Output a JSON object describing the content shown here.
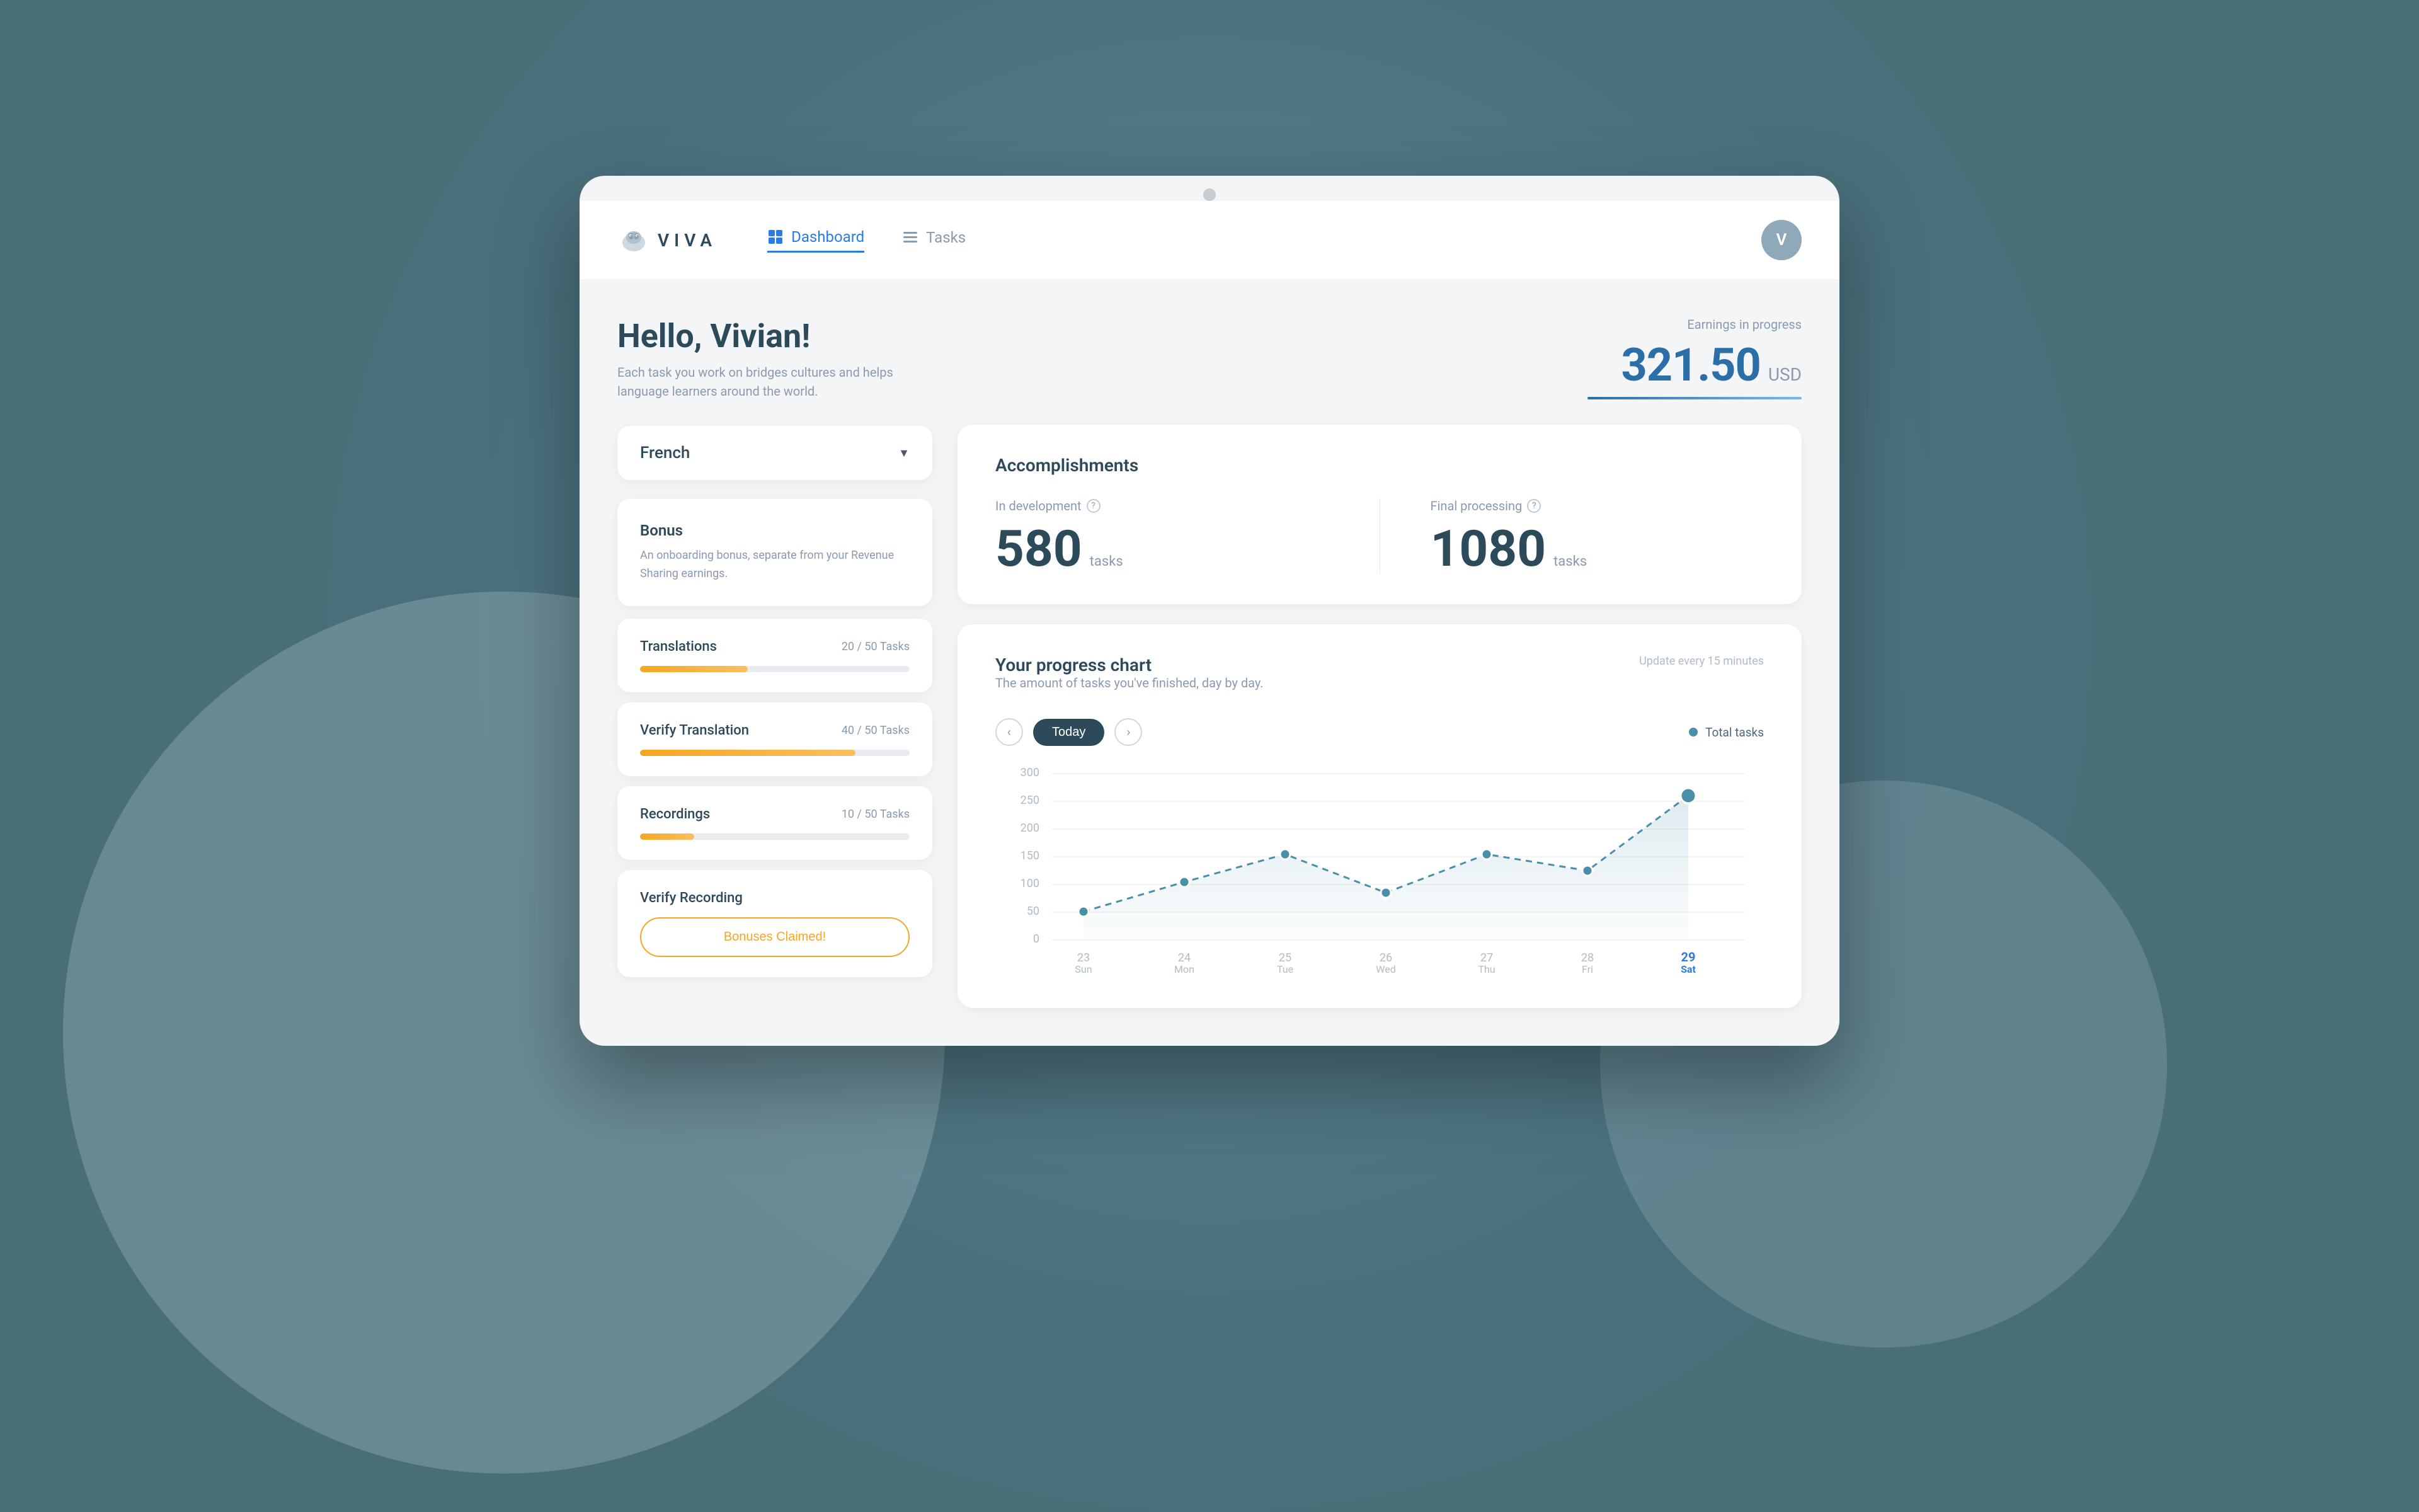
{
  "app": {
    "title": "VIVA",
    "window_dot_color": "#c8cdd4"
  },
  "nav": {
    "dashboard_label": "Dashboard",
    "tasks_label": "Tasks",
    "avatar_initial": "V"
  },
  "greeting": {
    "title": "Hello, Vivian!",
    "subtitle": "Each task you work on bridges cultures and helps language learners around the world."
  },
  "language_selector": {
    "value": "French",
    "arrow": "▼"
  },
  "bonus": {
    "title": "Bonus",
    "description": "An onboarding bonus, separate from your Revenue Sharing earnings."
  },
  "tasks": [
    {
      "name": "Translations",
      "current": 20,
      "total": 50,
      "progress_pct": 40,
      "label": "20 / 50 Tasks"
    },
    {
      "name": "Verify Translation",
      "current": 40,
      "total": 50,
      "progress_pct": 80,
      "label": "40 / 50 Tasks"
    },
    {
      "name": "Recordings",
      "current": 10,
      "total": 50,
      "progress_pct": 20,
      "label": "10 / 50 Tasks"
    },
    {
      "name": "Verify Recording",
      "is_claimed": true,
      "claimed_label": "Bonuses Claimed!"
    }
  ],
  "earnings": {
    "label": "Earnings in progress",
    "value": "321.50",
    "currency": "USD"
  },
  "accomplishments": {
    "title": "Accomplishments",
    "in_development_label": "In development",
    "final_processing_label": "Final processing",
    "in_development_value": "580",
    "in_development_unit": "tasks",
    "final_processing_value": "1080",
    "final_processing_unit": "tasks"
  },
  "chart": {
    "title": "Your progress chart",
    "subtitle": "The amount of tasks you've finished, day by day.",
    "update_text": "Update every 15 minutes",
    "today_label": "Today",
    "legend_label": "Total tasks",
    "nav_prev": "‹",
    "nav_next": "›",
    "days": [
      "23",
      "24",
      "25",
      "26",
      "27",
      "28",
      "29"
    ],
    "day_names": [
      "Sun",
      "Mon",
      "Tue",
      "Wed",
      "Thu",
      "Fri",
      "Sat"
    ],
    "values": [
      60,
      105,
      155,
      85,
      155,
      125,
      260
    ],
    "y_labels": [
      "300",
      "250",
      "200",
      "150",
      "100",
      "50",
      "0"
    ],
    "highlight_day": "29"
  }
}
